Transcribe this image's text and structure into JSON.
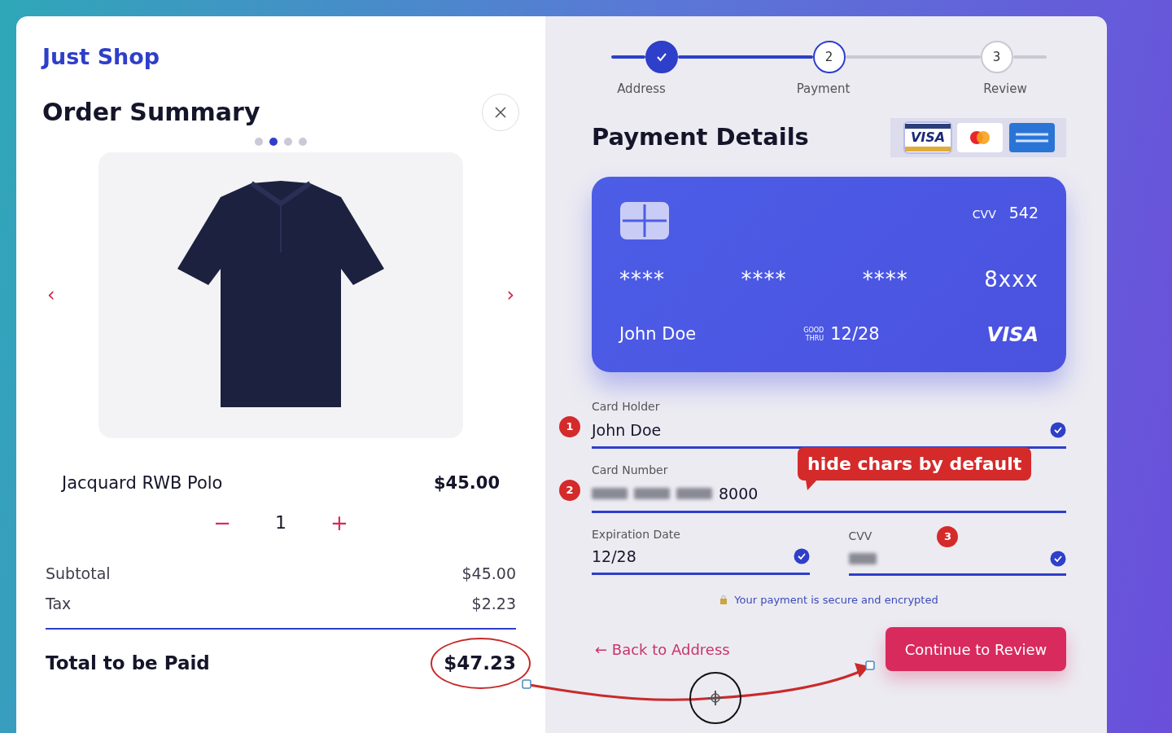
{
  "brand": "Just Shop",
  "order_summary": {
    "title": "Order Summary",
    "carousel_prev": "‹",
    "carousel_next": "›",
    "carousel_dots": [
      {
        "selected": false
      },
      {
        "selected": true
      },
      {
        "selected": false
      },
      {
        "selected": false
      }
    ],
    "product": {
      "name": "Jacquard RWB Polo",
      "price": "$45.00",
      "quantity": "1",
      "decrement": "−",
      "increment": "+"
    },
    "totals": [
      {
        "label": "Subtotal",
        "value": "$45.00"
      },
      {
        "label": "Tax",
        "value": "$2.23"
      }
    ],
    "total": {
      "label": "Total to be Paid",
      "value": "$47.23",
      "circled": true
    }
  },
  "steps": [
    {
      "label": "Address",
      "completed": true,
      "selected": false
    },
    {
      "number": "2",
      "label": "Payment",
      "completed": false,
      "selected": true
    },
    {
      "number": "3",
      "label": "Review",
      "completed": false,
      "selected": false
    }
  ],
  "payment": {
    "title": "Payment Details",
    "brands": [
      {
        "kind": "visa",
        "text": "VISA",
        "selected": true
      },
      {
        "kind": "mastercard",
        "selected": false
      },
      {
        "kind": "amex",
        "selected": false
      }
    ],
    "card": {
      "cvv_label": "CVV",
      "cvv": "542",
      "groups": [
        "****",
        "****",
        "****",
        "8xxx"
      ],
      "holder": "John Doe",
      "good_thru": [
        "GOOD",
        "THRU"
      ],
      "expiry": "12/28",
      "network": "VISA"
    },
    "fields": [
      {
        "kind": "full",
        "label": "Card Holder",
        "value": "John Doe",
        "valid": true,
        "annotation": "1"
      },
      {
        "kind": "full",
        "label": "Card Number",
        "value": "8000",
        "masked": true,
        "annotation": "2",
        "callout": "hide chars by default"
      },
      {
        "kind": "half",
        "label": "Expiration Date",
        "value": "12/28",
        "valid": true
      },
      {
        "kind": "half",
        "label": "CVV",
        "masked": true,
        "valid": true,
        "annotation": "3"
      }
    ],
    "secure_note": "Your payment is secure and encrypted",
    "back_link": "← Back to Address",
    "continue_button": "Continue to Review"
  }
}
